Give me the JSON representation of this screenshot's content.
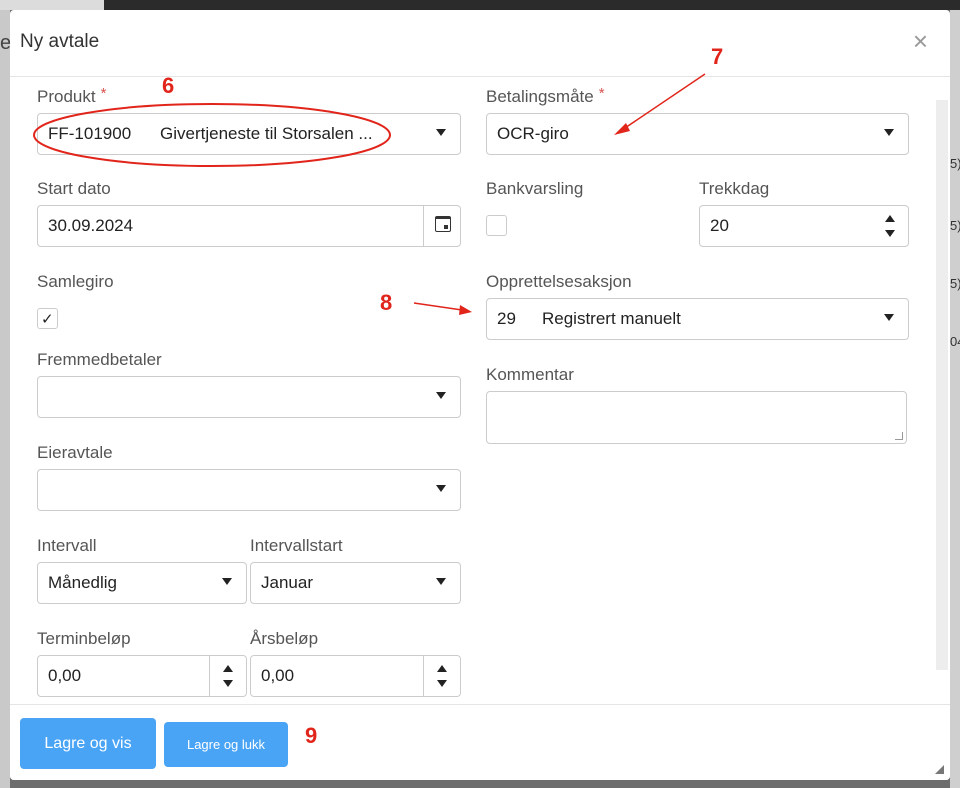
{
  "background": {
    "left_fragment": "e",
    "right_fragments": [
      "5)",
      "5)",
      "5)",
      "04"
    ]
  },
  "modal": {
    "title": "Ny avtale",
    "close_glyph": "×"
  },
  "form": {
    "produkt": {
      "label": "Produkt",
      "required": "*",
      "code": "FF-101900",
      "name": "Givertjeneste til Storsalen ..."
    },
    "betalingsmate": {
      "label": "Betalingsmåte",
      "required": "*",
      "value": "OCR-giro"
    },
    "start_dato": {
      "label": "Start dato",
      "value": "30.09.2024"
    },
    "bankvarsling": {
      "label": "Bankvarsling",
      "checked": false
    },
    "trekkdag": {
      "label": "Trekkdag",
      "value": "20"
    },
    "samlegiro": {
      "label": "Samlegiro",
      "checked": true,
      "check_glyph": "✓"
    },
    "opprettelsesaksjon": {
      "label": "Opprettelsesaksjon",
      "code": "29",
      "name": "Registrert manuelt"
    },
    "fremmedbetaler": {
      "label": "Fremmedbetaler",
      "value": ""
    },
    "kommentar": {
      "label": "Kommentar",
      "value": ""
    },
    "eieravtale": {
      "label": "Eieravtale",
      "value": ""
    },
    "intervall": {
      "label": "Intervall",
      "value": "Månedlig"
    },
    "intervallstart": {
      "label": "Intervallstart",
      "value": "Januar"
    },
    "terminbelop": {
      "label": "Terminbeløp",
      "value": "0,00"
    },
    "arsbelop": {
      "label": "Årsbeløp",
      "value": "0,00"
    }
  },
  "footer": {
    "save_view_label": "Lagre og vis",
    "save_close_label": "Lagre og lukk"
  },
  "annotations": {
    "n6": "6",
    "n7": "7",
    "n8": "8",
    "n9": "9",
    "color": "#e1251b"
  },
  "colors": {
    "button": "#4aa4f5",
    "required": "#d9534f"
  }
}
